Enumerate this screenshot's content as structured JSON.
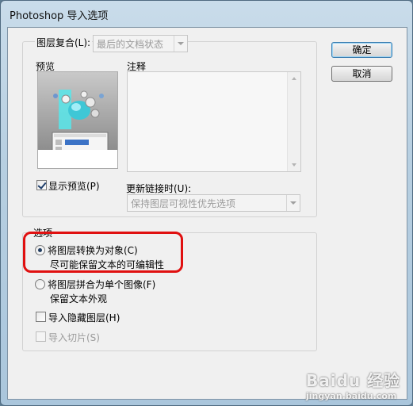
{
  "window": {
    "title": "Photoshop 导入选项"
  },
  "buttons": {
    "ok": "确定",
    "cancel": "取消"
  },
  "layer_comp": {
    "label": "图层复合(L):",
    "value": "最后的文档状态"
  },
  "preview": {
    "label": "预览",
    "show_label": "显示预览(P)",
    "show_checked": true
  },
  "notes": {
    "label": "注释"
  },
  "update_link": {
    "label": "更新链接时(U):",
    "value": "保持图层可视性优先选项"
  },
  "options": {
    "title": "选项",
    "convert": {
      "label": "将图层转换为对象(C)",
      "desc": "尽可能保留文本的可编辑性",
      "checked": true
    },
    "flatten": {
      "label": "将图层拼合为单个图像(F)",
      "desc": "保留文本外观",
      "checked": false
    },
    "import_hidden": {
      "label": "导入隐藏图层(H)",
      "checked": false
    },
    "import_slices": {
      "label": "导入切片(S)",
      "checked": false
    }
  },
  "colors": {
    "highlight": "#e01010",
    "title_bar": "#b7cfe1"
  },
  "watermark": {
    "logo": "Baidu 经验",
    "url": "jingyan.baidu.com"
  }
}
